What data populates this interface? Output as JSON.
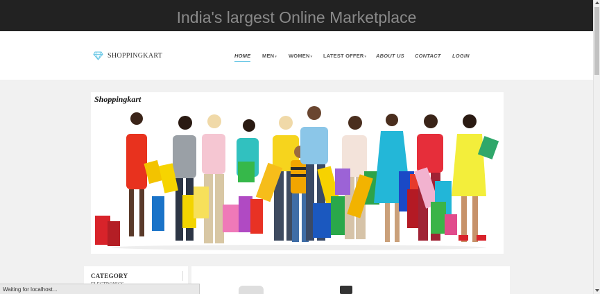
{
  "topbar": {
    "title": "India's largest Online Marketplace"
  },
  "header": {
    "logo_text": "SHOPPINGKART",
    "nav": [
      {
        "label": "HOME",
        "active": true,
        "italic": true,
        "caret": false
      },
      {
        "label": "MEN",
        "active": false,
        "italic": false,
        "caret": true
      },
      {
        "label": "WOMEN",
        "active": false,
        "italic": false,
        "caret": true
      },
      {
        "label": "LATEST OFFER",
        "active": false,
        "italic": false,
        "caret": true
      },
      {
        "label": "ABOUT US",
        "active": false,
        "italic": true,
        "caret": false
      },
      {
        "label": "CONTACT",
        "active": false,
        "italic": true,
        "caret": false
      },
      {
        "label": "LOGIN",
        "active": false,
        "italic": true,
        "caret": false
      }
    ]
  },
  "banner": {
    "brand": "Shoppingkart"
  },
  "sidebar": {
    "category_heading": "CATEGORY",
    "first_item": "ELECTRONICS"
  },
  "status_bar": {
    "text": "Waiting for localhost..."
  },
  "colors": {
    "topbar_bg": "#222222",
    "accent": "#5fc3e4",
    "page_bg": "#f1f1f1"
  }
}
